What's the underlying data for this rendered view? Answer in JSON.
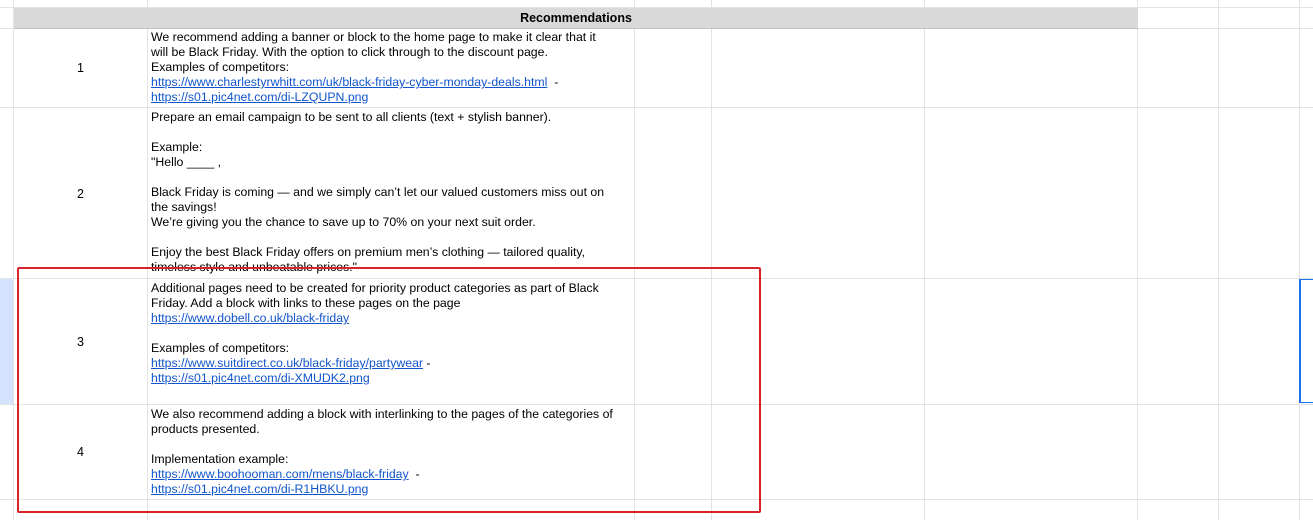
{
  "sheet": {
    "header": "Recommendations",
    "rows": [
      {
        "number": "1",
        "lines": [
          {
            "text": "We recommend adding a banner or block to the home page to make it clear that it"
          },
          {
            "text": "will be Black Friday. With the option to click through to the discount page."
          },
          {
            "text": "Examples of competitors:"
          },
          {
            "link": "https://www.charlestyrwhitt.com/uk/black-friday-cyber-monday-deals.html",
            "suffix": "  -"
          },
          {
            "link": "https://s01.pic4net.com/di-LZQUPN.png"
          }
        ]
      },
      {
        "number": "2",
        "lines": [
          {
            "text": "Prepare an email campaign to be sent to all clients (text + stylish banner)."
          },
          {
            "text": ""
          },
          {
            "text": "Example:"
          },
          {
            "text": "\"Hello ____ ,"
          },
          {
            "text": ""
          },
          {
            "text": "Black Friday is coming — and we simply can’t let our valued customers miss out on"
          },
          {
            "text": "the savings!"
          },
          {
            "text": "We’re giving you the chance to save up to 70% on your next suit order."
          },
          {
            "text": ""
          },
          {
            "text": "Enjoy the best Black Friday offers on premium men’s clothing — tailored quality,"
          },
          {
            "text": "timeless style and unbeatable prices.\""
          }
        ]
      },
      {
        "number": "3",
        "lines": [
          {
            "text": "Additional pages need to be created for priority product categories as part of Black"
          },
          {
            "text": "Friday. Add a block with links to these pages on the page"
          },
          {
            "link": "https://www.dobell.co.uk/black-friday"
          },
          {
            "text": ""
          },
          {
            "text": "Examples of competitors:"
          },
          {
            "link": "https://www.suitdirect.co.uk/black-friday/partywear",
            "suffix": " -"
          },
          {
            "link": "https://s01.pic4net.com/di-XMUDK2.png"
          }
        ]
      },
      {
        "number": "4",
        "lines": [
          {
            "text": "We also recommend adding a block with interlinking to the pages of the categories of"
          },
          {
            "text": "products presented."
          },
          {
            "text": ""
          },
          {
            "text": "Implementation example:"
          },
          {
            "link": "https://www.boohooman.com/mens/black-friday",
            "suffix": "  -"
          },
          {
            "link": "https://s01.pic4net.com/di-R1HBKU.png"
          }
        ]
      }
    ]
  },
  "colors": {
    "header_bg": "#d9d9d9",
    "link": "#1155cc",
    "highlight_box": "#d9232b",
    "selected_row_header": "#d3e3fd"
  }
}
